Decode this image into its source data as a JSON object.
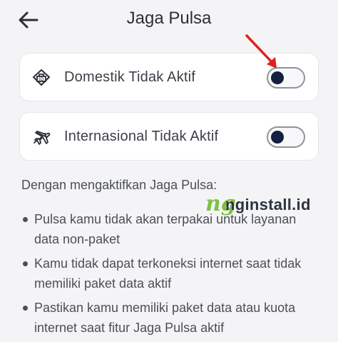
{
  "header": {
    "title": "Jaga Pulsa",
    "back_icon": "arrow-left-icon"
  },
  "options": [
    {
      "label": "Domestik Tidak Aktif",
      "icon": "home-domestic-icon",
      "enabled": false
    },
    {
      "label": "Internasional Tidak Aktif",
      "icon": "airplane-icon",
      "enabled": false
    }
  ],
  "info": {
    "intro": "Dengan mengaktifkan Jaga Pulsa:",
    "bullets": [
      "Pulsa kamu tidak akan terpakai untuk layanan data non-paket",
      "Kamu tidak dapat terkoneksi internet saat tidak memiliki paket data aktif",
      "Pastikan kamu memiliki paket data atau kuota internet saat fitur Jaga Pulsa aktif"
    ]
  },
  "watermark": {
    "mark": "ng",
    "text": "nginstall.id"
  },
  "colors": {
    "accent_arrow": "#e0201b",
    "toggle_knob": "#13203f",
    "watermark_green": "#7cc242"
  }
}
